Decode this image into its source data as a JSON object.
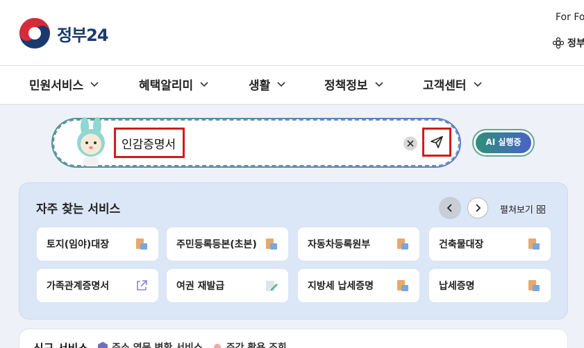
{
  "header": {
    "logo_text": "정부24",
    "for_foreign": "For Fo",
    "jeong_link": "정부"
  },
  "nav": {
    "items": [
      {
        "label": "민원서비스"
      },
      {
        "label": "혜택알리미"
      },
      {
        "label": "생활"
      },
      {
        "label": "정책정보"
      },
      {
        "label": "고객센터"
      }
    ]
  },
  "search": {
    "value": "인감증명서",
    "ai_label": "AI 실행중"
  },
  "frequent": {
    "title": "자주 찾는 서비스",
    "expand_label": "펼쳐보기",
    "cards": [
      {
        "label": "토지(임야)대장",
        "icon": "document-icon"
      },
      {
        "label": "주민등록등본(초본)",
        "icon": "document-icon"
      },
      {
        "label": "자동차등록원부",
        "icon": "document-icon"
      },
      {
        "label": "건축물대장",
        "icon": "document-icon"
      },
      {
        "label": "가족관계증명서",
        "icon": "external-link-icon"
      },
      {
        "label": "여권 재발급",
        "icon": "pencil-icon"
      },
      {
        "label": "지방세 납세증명",
        "icon": "document-icon"
      },
      {
        "label": "납세증명",
        "icon": "document-icon"
      }
    ]
  },
  "bottom": {
    "label": "신규 서비스",
    "tags": [
      {
        "label": "주소 영문 변환 서비스"
      },
      {
        "label": "주간 활용 조회"
      }
    ]
  },
  "colors": {
    "accent_red": "#d11a1a",
    "brand_navy": "#1a3a6c",
    "panel_bg": "#dbe6f6"
  }
}
